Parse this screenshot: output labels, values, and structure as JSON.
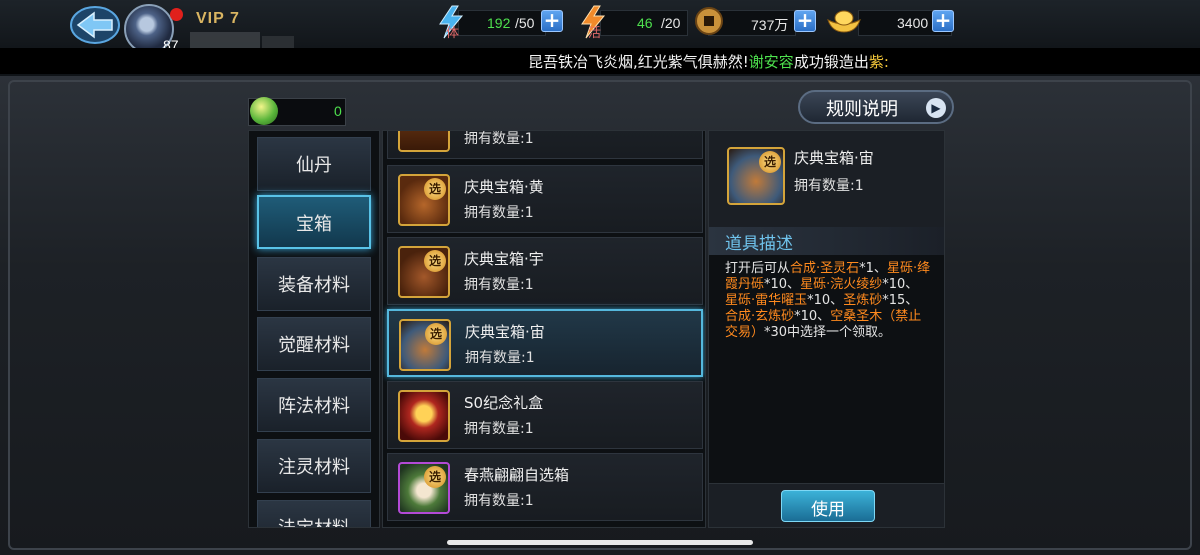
{
  "header": {
    "vip": "VIP 7",
    "level": "87",
    "stamina": {
      "label": "体",
      "current": "192",
      "max": "/50"
    },
    "vitality": {
      "label": "活",
      "current": "46",
      "max": "/20"
    },
    "coins": "737万",
    "gold": "3400"
  },
  "ticker": {
    "part1": "昆吾铁冶飞炎烟,红光紫气俱赫然!",
    "name": "谢安容",
    "part2": "成功锻造出",
    "part3": "紫:"
  },
  "gem_count": "0",
  "rules_label": "规则说明",
  "categories": [
    "仙丹",
    "宝箱",
    "装备材料",
    "觉醒材料",
    "阵法材料",
    "注灵材料",
    "法宝材料"
  ],
  "items": [
    {
      "name": "",
      "count": "拥有数量:1"
    },
    {
      "name": "庆典宝箱·黄",
      "count": "拥有数量:1",
      "badge": "选"
    },
    {
      "name": "庆典宝箱·宇",
      "count": "拥有数量:1",
      "badge": "选"
    },
    {
      "name": "庆典宝箱·宙",
      "count": "拥有数量:1",
      "badge": "选"
    },
    {
      "name": "S0纪念礼盒",
      "count": "拥有数量:1"
    },
    {
      "name": "春燕翩翩自选箱",
      "count": "拥有数量:1",
      "badge": "选"
    }
  ],
  "detail": {
    "name": "庆典宝箱·宙",
    "count": "拥有数量:1",
    "badge": "选",
    "desc_title": "道具描述",
    "desc": [
      {
        "t": "打开后可从",
        "c": "white"
      },
      {
        "t": "合成·圣灵石",
        "c": "orange"
      },
      {
        "t": "*1、",
        "c": "white"
      },
      {
        "t": "星砾·绛霞丹砾",
        "c": "orange"
      },
      {
        "t": "*10、",
        "c": "white"
      },
      {
        "t": "星砾·浣火绫纱",
        "c": "orange"
      },
      {
        "t": "*10、",
        "c": "white"
      },
      {
        "t": "星砾·雷华曜玉",
        "c": "orange"
      },
      {
        "t": "*10、",
        "c": "white"
      },
      {
        "t": "圣炼砂",
        "c": "orange"
      },
      {
        "t": "*15、",
        "c": "white"
      },
      {
        "t": "合成·玄炼砂",
        "c": "orange"
      },
      {
        "t": "*10、",
        "c": "white"
      },
      {
        "t": "空桑圣木（禁止交易）",
        "c": "orange"
      },
      {
        "t": "*30中选择一个领取。",
        "c": "white"
      }
    ],
    "use_label": "使用"
  }
}
